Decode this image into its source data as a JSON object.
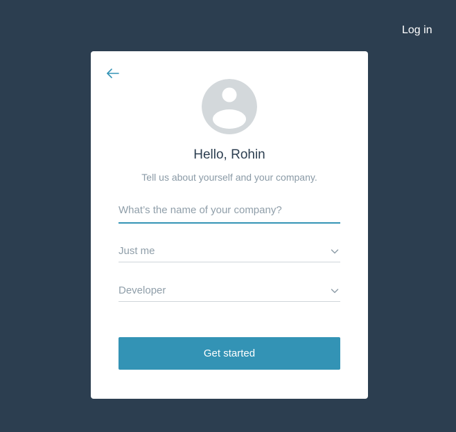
{
  "header": {
    "login_label": "Log in"
  },
  "card": {
    "back_icon": "arrow-left-icon",
    "avatar_icon": "user-avatar-icon",
    "greeting": "Hello, Rohin",
    "subtitle": "Tell us about yourself and your company.",
    "company_field": {
      "value": "",
      "placeholder": "What’s the name of your company?"
    },
    "team_size_select": {
      "selected": "Just me",
      "icon": "chevron-down-icon"
    },
    "role_select": {
      "selected": "Developer",
      "icon": "chevron-down-icon"
    },
    "submit_label": "Get started"
  },
  "colors": {
    "background": "#2c3e50",
    "accent": "#3393b5",
    "card": "#ffffff",
    "muted_text": "#8f9ea9",
    "avatar": "#d3d8db"
  }
}
